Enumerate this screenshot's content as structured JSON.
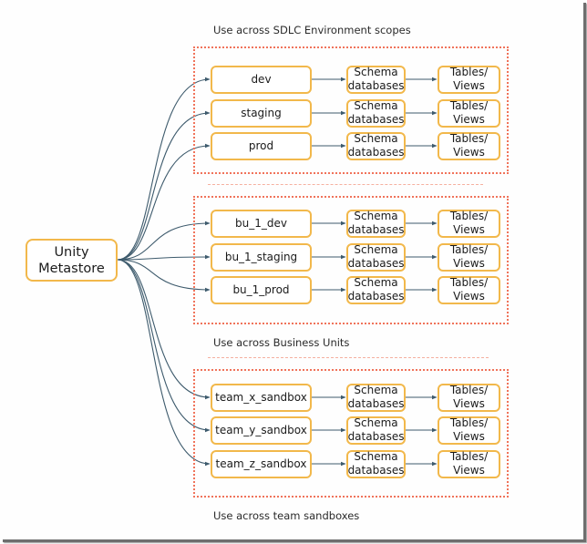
{
  "root": {
    "label": "Unity\nMetastore"
  },
  "colors": {
    "node_border": "#f2b84b",
    "group_border": "#f0735a",
    "separator": "#f5b0a0",
    "edge": "#3d5a6c"
  },
  "groups": [
    {
      "caption": "Use across SDLC Environment scopes",
      "rows": [
        {
          "catalog": "dev",
          "schema": "Schema\ndatabases",
          "tables": "Tables/\nViews"
        },
        {
          "catalog": "staging",
          "schema": "Schema\ndatabases",
          "tables": "Tables/\nViews"
        },
        {
          "catalog": "prod",
          "schema": "Schema\ndatabases",
          "tables": "Tables/\nViews"
        }
      ]
    },
    {
      "caption": "Use across Business Units",
      "rows": [
        {
          "catalog": "bu_1_dev",
          "schema": "Schema\ndatabases",
          "tables": "Tables/\nViews"
        },
        {
          "catalog": "bu_1_staging",
          "schema": "Schema\ndatabases",
          "tables": "Tables/\nViews"
        },
        {
          "catalog": "bu_1_prod",
          "schema": "Schema\ndatabases",
          "tables": "Tables/\nViews"
        }
      ]
    },
    {
      "caption": "Use across team sandboxes",
      "rows": [
        {
          "catalog": "team_x_sandbox",
          "schema": "Schema\ndatabases",
          "tables": "Tables/\nViews"
        },
        {
          "catalog": "team_y_sandbox",
          "schema": "Schema\ndatabases",
          "tables": "Tables/\nViews"
        },
        {
          "catalog": "team_z_sandbox",
          "schema": "Schema\ndatabases",
          "tables": "Tables/\nViews"
        }
      ]
    }
  ]
}
